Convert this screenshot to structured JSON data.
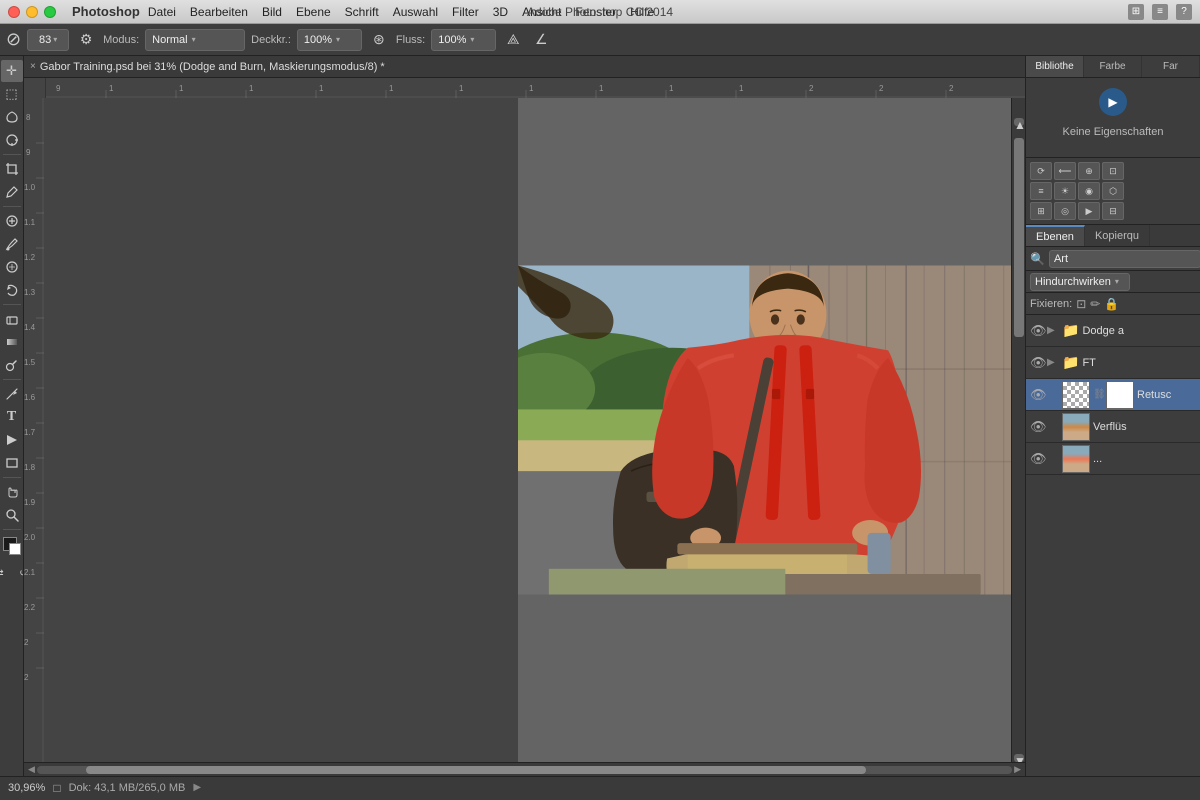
{
  "titlebar": {
    "app_name": "Photoshop",
    "title": "Adobe Photoshop CC 2014",
    "close_label": "×",
    "min_label": "–",
    "max_label": "+",
    "menu_items": [
      "Datei",
      "Bearbeiten",
      "Bild",
      "Ebene",
      "Schrift",
      "Auswahl",
      "Filter",
      "3D",
      "Ansicht",
      "Fenster",
      "Hilfe"
    ]
  },
  "options_bar": {
    "brush_size": "83",
    "modus_label": "Modus:",
    "modus_value": "Normal",
    "deckkraft_label": "Deckkr.:",
    "deckkraft_value": "100%",
    "fluss_label": "Fluss:",
    "fluss_value": "100%"
  },
  "tab": {
    "close": "×",
    "title": "Gabor Training.psd bei 31% (Dodge and Burn, Maskierungsmodus/8) *"
  },
  "canvas": {
    "ruler_marks_h": [
      "9",
      "1",
      "1",
      "1",
      "1",
      "1",
      "1",
      "1",
      "1",
      "1",
      "1",
      "1",
      "1",
      "1",
      "1",
      "1",
      "2",
      "2"
    ],
    "ruler_marks_v": [
      "8",
      "9",
      "1.0",
      "1.1",
      "1.2",
      "1.3",
      "1.4",
      "1.5",
      "1.6",
      "1.7",
      "1.8",
      "1.9",
      "2.0",
      "2.1",
      "2.2"
    ]
  },
  "right_panel": {
    "tabs": [
      "Bibliothe",
      "Farbe",
      "Far"
    ],
    "play_icon": "▶",
    "keine_text": "Keine Eigenschaften",
    "panel_tabs_2": [
      "Ebenen",
      "Kopierqu"
    ]
  },
  "layers": {
    "filter_placeholder": "Art",
    "blend_mode": "Hindurchwirken",
    "fixieren_label": "Fixieren:",
    "layers_list": [
      {
        "name": "Dodge a",
        "type": "folder",
        "visible": true,
        "expanded": true,
        "color": "orange"
      },
      {
        "name": "FT",
        "type": "folder",
        "visible": true,
        "expanded": true,
        "color": "none"
      },
      {
        "name": "Retusc",
        "type": "layer",
        "visible": true,
        "has_mask": true,
        "thumb": "checker"
      },
      {
        "name": "Verflüs",
        "type": "layer",
        "visible": true,
        "thumb": "person"
      },
      {
        "name": "...",
        "type": "layer",
        "visible": true,
        "thumb": "empty"
      }
    ]
  },
  "status_bar": {
    "zoom": "30,96%",
    "doc_info": "Dok: 43,1 MB/265,0 MB",
    "arrow": "▶"
  },
  "tools": [
    {
      "name": "move",
      "icon": "✛"
    },
    {
      "name": "rectangular-marquee",
      "icon": "⬚"
    },
    {
      "name": "lasso",
      "icon": "⌒"
    },
    {
      "name": "quick-select",
      "icon": "✿"
    },
    {
      "name": "crop",
      "icon": "⊡"
    },
    {
      "name": "eyedropper",
      "icon": "𝒊"
    },
    {
      "name": "spot-healing",
      "icon": "✙"
    },
    {
      "name": "brush",
      "icon": "✏"
    },
    {
      "name": "clone-stamp",
      "icon": "⊕"
    },
    {
      "name": "history-brush",
      "icon": "↩"
    },
    {
      "name": "eraser",
      "icon": "◻"
    },
    {
      "name": "gradient",
      "icon": "▦"
    },
    {
      "name": "dodge",
      "icon": "◑"
    },
    {
      "name": "pen",
      "icon": "⌕"
    },
    {
      "name": "type",
      "icon": "T"
    },
    {
      "name": "path-selection",
      "icon": "↖"
    },
    {
      "name": "rectangle-shape",
      "icon": "▭"
    },
    {
      "name": "hand",
      "icon": "✋"
    },
    {
      "name": "zoom",
      "icon": "🔍"
    },
    {
      "name": "foreground-color",
      "icon": "■"
    },
    {
      "name": "background-color",
      "icon": "□"
    }
  ]
}
